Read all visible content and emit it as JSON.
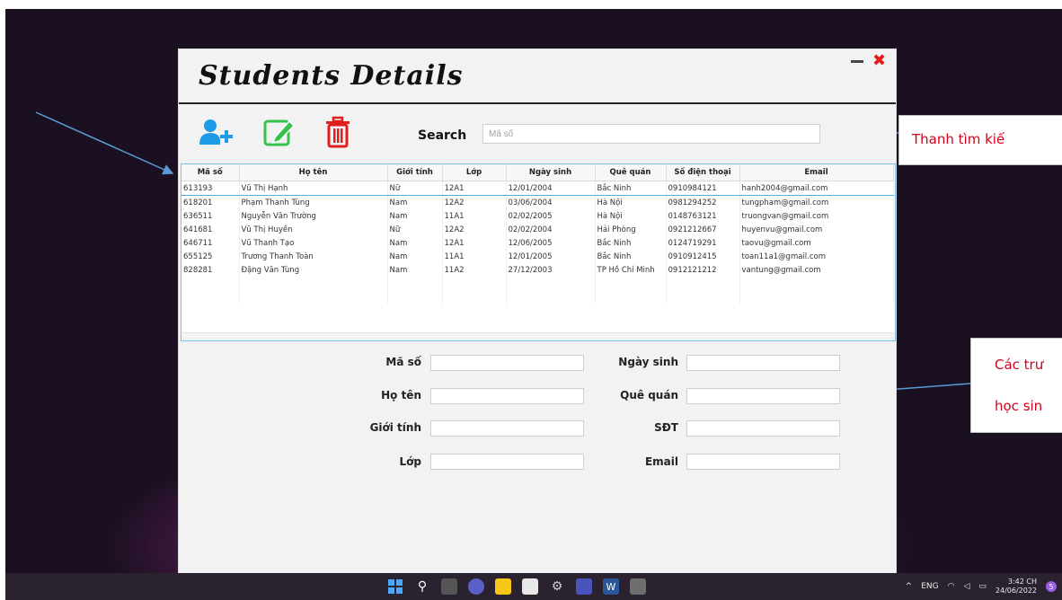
{
  "app": {
    "title": "Students Details",
    "search_label": "Search",
    "search_placeholder": "Mã số"
  },
  "table": {
    "columns": [
      "Mã số",
      "Họ tên",
      "Giới tính",
      "Lớp",
      "Ngày sinh",
      "Quê quán",
      "Số điện thoại",
      "Email"
    ],
    "rows": [
      [
        "613193",
        "Vũ Thị Hạnh",
        "Nữ",
        "12A1",
        "12/01/2004",
        "Bắc Ninh",
        "0910984121",
        "hanh2004@gmail.com"
      ],
      [
        "618201",
        "Phạm Thanh Tùng",
        "Nam",
        "12A2",
        "03/06/2004",
        "Hà Nội",
        "0981294252",
        "tungpham@gmail.com"
      ],
      [
        "636511",
        "Nguyễn Văn Trường",
        "Nam",
        "11A1",
        "02/02/2005",
        "Hà Nội",
        "0148763121",
        "truongvan@gmail.com"
      ],
      [
        "641681",
        "Vũ Thị Huyền",
        "Nữ",
        "12A2",
        "02/02/2004",
        "Hải Phòng",
        "0921212667",
        "huyenvu@gmail.com"
      ],
      [
        "646711",
        "Vũ Thanh Tạo",
        "Nam",
        "12A1",
        "12/06/2005",
        "Bắc Ninh",
        "0124719291",
        "taovu@gmail.com"
      ],
      [
        "655125",
        "Trương Thanh Toàn",
        "Nam",
        "11A1",
        "12/01/2005",
        "Bắc Ninh",
        "0910912415",
        "toan11a1@gmail.com"
      ],
      [
        "828281",
        "Đặng Văn Tùng",
        "Nam",
        "11A2",
        "27/12/2003",
        "TP Hồ Chí Minh",
        "0912121212",
        "vantung@gmail.com"
      ]
    ]
  },
  "form": {
    "ma_so": "Mã số",
    "ho_ten": "Họ tên",
    "gioi_tinh": "Giới tính",
    "lop": "Lớp",
    "ngay_sinh": "Ngày sinh",
    "que_quan": "Quê quán",
    "sdt": "SĐT",
    "email": "Email"
  },
  "callouts": {
    "search": "Thanh tìm kiế",
    "fields_line1": "Các trư",
    "fields_line2": "học sin"
  },
  "taskbar": {
    "lang": "ENG",
    "time": "3:42 CH",
    "date": "24/06/2022",
    "notifications": "5"
  },
  "colors": {
    "add_icon": "#1e9be6",
    "edit_icon": "#36c24a",
    "delete_icon": "#e01e1e",
    "close_icon": "#e51b1b",
    "callout_text": "#d0021b",
    "arrow": "#5b9bd5"
  },
  "icons": [
    "add-user-icon",
    "edit-icon",
    "trash-icon",
    "minimize-icon",
    "close-icon"
  ]
}
